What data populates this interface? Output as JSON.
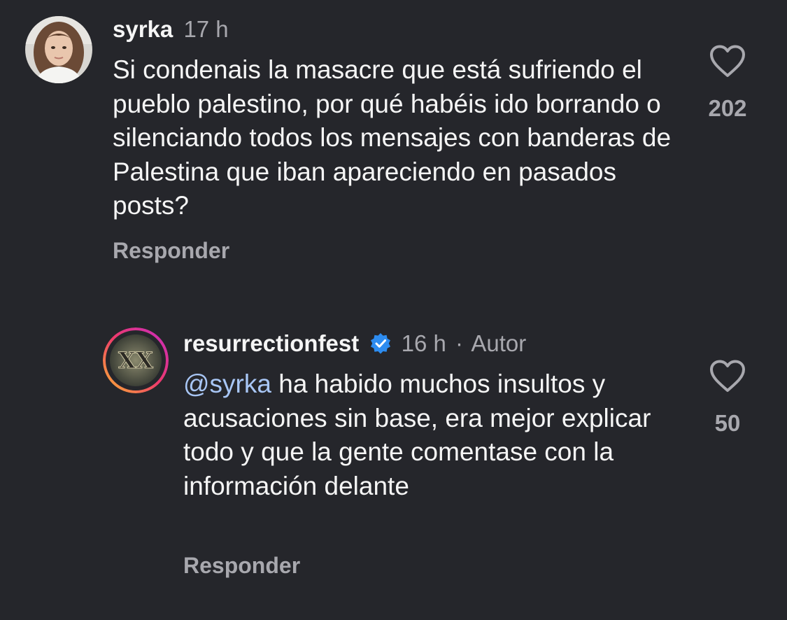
{
  "comments": [
    {
      "username": "syrka",
      "time": "17 h",
      "text": "Si condenais la masacre que está sufriendo el pueblo palestino, por qué habéis ido borrando o silenciando todos los mensajes con banderas de Palestina que iban apareciendo en pasados posts?",
      "likes": "202",
      "reply_label": "Responder"
    },
    {
      "username": "resurrectionfest",
      "verified": true,
      "time": "16 h",
      "separator": "·",
      "author_tag": "Autor",
      "mention": "@syrka",
      "text": "ha habido muchos insultos y acusaciones sin base, era mejor explicar todo y que la gente comentase con la información delante",
      "likes": "50",
      "reply_label": "Responder"
    }
  ],
  "colors": {
    "background": "#25262b",
    "text": "#f5f5f5",
    "secondary_text": "#a8a8ae",
    "mention": "#a8c6f5",
    "verified_badge": "#2d8cf0",
    "story_ring_start": "#f9b233",
    "story_ring_end": "#c82bbf"
  },
  "icons": {
    "like": "heart-outline-icon",
    "verified": "verified-badge-icon"
  }
}
